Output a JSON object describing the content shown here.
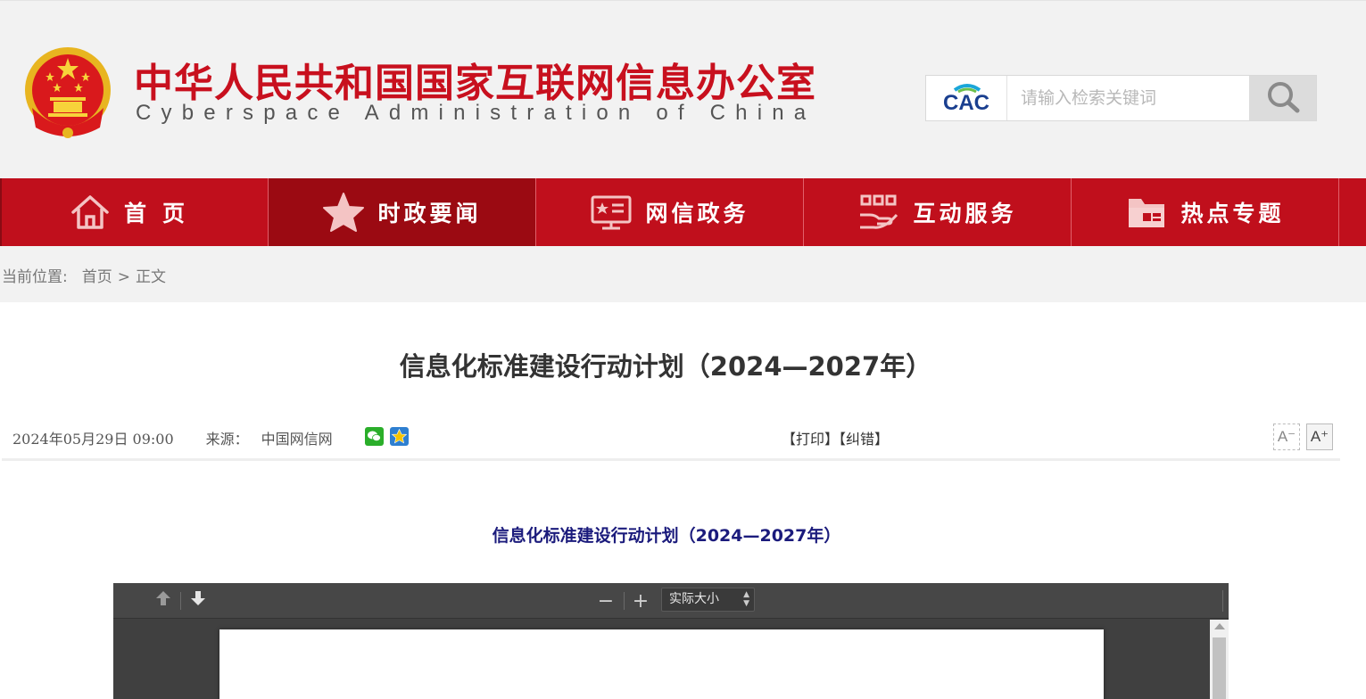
{
  "header": {
    "title_cn": "中华人民共和国国家互联网信息办公室",
    "title_en": "Cyberspace Administration of China",
    "logo_text": "CAC",
    "search_placeholder": "请输入检索关键词"
  },
  "nav": {
    "items": [
      {
        "label": "首页",
        "icon": "home-icon",
        "active": false
      },
      {
        "label": "时政要闻",
        "icon": "star-icon",
        "active": true
      },
      {
        "label": "网信政务",
        "icon": "monitor-icon",
        "active": false
      },
      {
        "label": "互动服务",
        "icon": "hand-service-icon",
        "active": false
      },
      {
        "label": "热点专题",
        "icon": "folder-icon",
        "active": false
      }
    ]
  },
  "breadcrumb": {
    "label": "当前位置:",
    "home": "首页",
    "separator": ">",
    "current": "正文"
  },
  "article": {
    "title": "信息化标准建设行动计划（2024—2027年）",
    "date": "2024年05月29日 09:00",
    "source_label": "来源：",
    "source": "中国网信网",
    "print": "【打印】",
    "correction": "【纠错】",
    "font_smaller": "A⁻",
    "font_larger": "A⁺",
    "body_title": "信息化标准建设行动计划（2024—2027年）"
  },
  "pdf_viewer": {
    "zoom_label": "实际大小",
    "zoom_out": "−",
    "zoom_in": "+"
  },
  "colors": {
    "brand_red": "#c00f1c",
    "active_nav": "#9b0a12",
    "body_title": "#1b1b7c"
  }
}
